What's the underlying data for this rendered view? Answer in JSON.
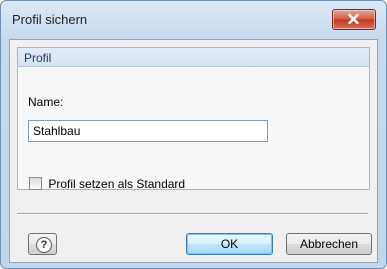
{
  "window": {
    "title": "Profil sichern"
  },
  "group": {
    "title": "Profil",
    "name_label": "Name:",
    "name_value": "Stahlbau",
    "checkbox_label": "Profil setzen als Standard",
    "checkbox_checked": false
  },
  "buttons": {
    "ok": "OK",
    "cancel": "Abbrechen"
  },
  "icons": {
    "close": "close-icon",
    "help": "help-icon"
  }
}
